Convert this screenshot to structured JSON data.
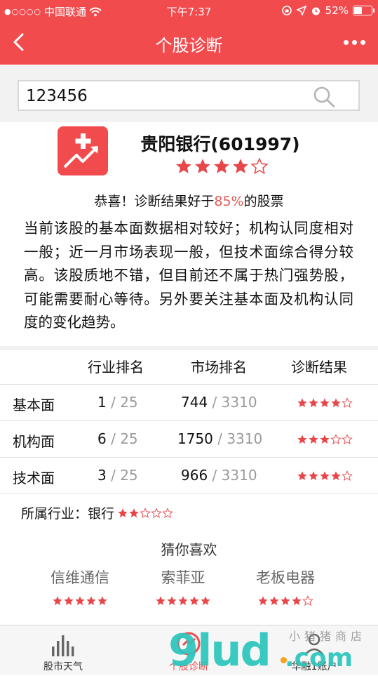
{
  "status_bar": {
    "signal": "●○○○○",
    "carrier": "中国联通",
    "time": "下午7:37",
    "battery": "52%",
    "battery_level": 0.52
  },
  "nav": {
    "title": "个股诊断"
  },
  "search": {
    "value": "123456"
  },
  "stock": {
    "name": "贵阳银行(601997)",
    "rating": 4,
    "rating_max": 5
  },
  "verdict": {
    "prefix": "恭喜！诊断结果好于",
    "percent": "85%",
    "suffix": "的股票"
  },
  "summary": "当前该股的基本面数据相对较好；机构认同度相对一般；近一月市场表现一般，但技术面综合得分较高。该股质地不错，但目前还不属于热门强势股，可能需要耐心等待。另外要关注基本面及机构认同度的变化趋势。",
  "table": {
    "headers": [
      "行业排名",
      "市场排名",
      "诊断结果"
    ],
    "rows": [
      {
        "label": "基本面",
        "industry_rank": "1",
        "industry_total": "25",
        "market_rank": "744",
        "market_total": "3310",
        "stars": 4
      },
      {
        "label": "机构面",
        "industry_rank": "6",
        "industry_total": "25",
        "market_rank": "1750",
        "market_total": "3310",
        "stars": 3
      },
      {
        "label": "技术面",
        "industry_rank": "3",
        "industry_total": "25",
        "market_rank": "966",
        "market_total": "3310",
        "stars": 4
      }
    ],
    "separator": "/"
  },
  "industry": {
    "label": "所属行业：",
    "name": "银行",
    "stars": 2
  },
  "guess": {
    "title": "猜你喜欢",
    "items": [
      {
        "name": "信维通信",
        "stars": 5
      },
      {
        "name": "索菲亚",
        "stars": 5
      },
      {
        "name": "老板电器",
        "stars": 4
      }
    ]
  },
  "tabs": [
    {
      "label": "股市天气",
      "icon": "bar-chart-icon"
    },
    {
      "label": "个股诊断",
      "icon": "diagnosis-icon"
    },
    {
      "label": "华融1账户",
      "icon": "account-icon"
    }
  ],
  "watermark": {
    "logo": "9lud",
    "com": ".com",
    "text": "小猪猪商店"
  },
  "colors": {
    "brand": "#f24b4e",
    "star": "#e8474a",
    "highlight": "#e05b57"
  }
}
